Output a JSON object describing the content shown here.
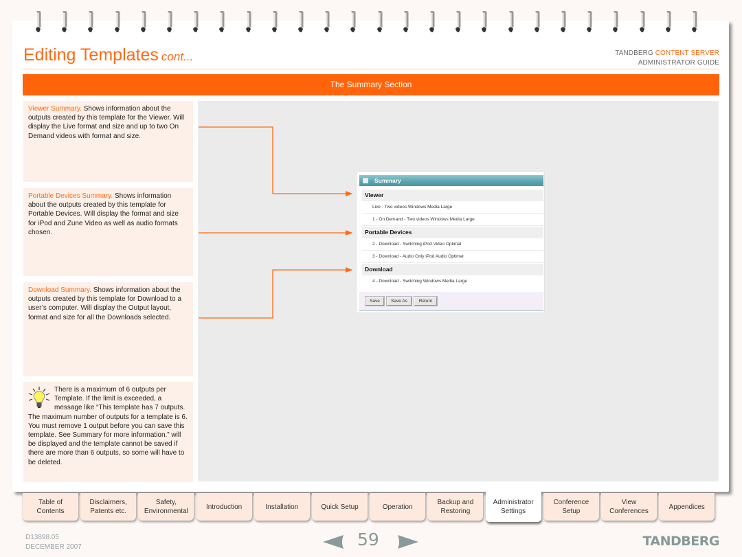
{
  "header": {
    "title": "Editing Templates",
    "title_suffix": "cont...",
    "brand_line1_prefix": "TANDBERG",
    "brand_line1_accent": "CONTENT SERVER",
    "brand_line2": "ADMINISTRATOR GUIDE"
  },
  "section_title": "The Summary Section",
  "notes": [
    {
      "lead": "Viewer Summary.",
      "text": " Shows information about the outputs created by this template for the Viewer. Will display the Live format and size and up to two On Demand videos with format and size."
    },
    {
      "lead": "Portable Devices Summary.",
      "text": " Shows information about the outputs created by this template for Portable Devices. Will display the format and size for iPod and Zune Video as well as audio formats chosen."
    },
    {
      "lead": "Download Summary.",
      "text": " Shows information about the outputs created by this template for Download to a user’s computer. Will display the Output layout, format and size for all the Downloads selected."
    }
  ],
  "tip": {
    "icon": "lightbulb-icon",
    "text": "There is a maximum of 6 outputs per Template. If the limit is exceeded, a message like “This template has 7 outputs. The maximum number of outputs for a template is 6. You must remove 1 output before you can save this template. See Summary for more information.” will be displayed and the template cannot be saved if there are more than 6 outputs, so some will have to be deleted."
  },
  "summary_panel": {
    "header": "Summary",
    "groups": [
      {
        "title": "Viewer",
        "rows": [
          "Live - Two videos Windows Media Large",
          "1 - On Demand - Two videos Windows Media Large"
        ]
      },
      {
        "title": "Portable Devices",
        "rows": [
          "2 - Download - Switching iPod Video Optimal",
          "3 - Download - Audio Only iPod Audio Optimal"
        ]
      },
      {
        "title": "Download",
        "rows": [
          "4 - Download - Switching Windows Media Large"
        ]
      }
    ],
    "buttons": {
      "save": "Save",
      "save_as": "Save As",
      "return": "Return"
    }
  },
  "nav_tabs": [
    {
      "label": "Table of\nContents",
      "active": false
    },
    {
      "label": "Disclaimers,\nPatents etc.",
      "active": false
    },
    {
      "label": "Safety,\nEnvironmental",
      "active": false
    },
    {
      "label": "Introduction",
      "active": false
    },
    {
      "label": "Installation",
      "active": false
    },
    {
      "label": "Quick Setup",
      "active": false
    },
    {
      "label": "Operation",
      "active": false
    },
    {
      "label": "Backup and\nRestoring",
      "active": false
    },
    {
      "label": "Administrator\nSettings",
      "active": true
    },
    {
      "label": "Conference\nSetup",
      "active": false
    },
    {
      "label": "View\nConferences",
      "active": false
    },
    {
      "label": "Appendices",
      "active": false
    }
  ],
  "footer": {
    "doc_id": "D13898.05",
    "date": "DECEMBER 2007",
    "page_number": "59",
    "logo": "TANDBERG"
  },
  "colors": {
    "accent": "#ff6a13",
    "section_bar": "#ff640a",
    "note_bg": "#fdf0e8",
    "panel_bg": "#ebebeb",
    "summary_header": "#5aa3ae",
    "pager_gray": "#8a9a9a"
  }
}
